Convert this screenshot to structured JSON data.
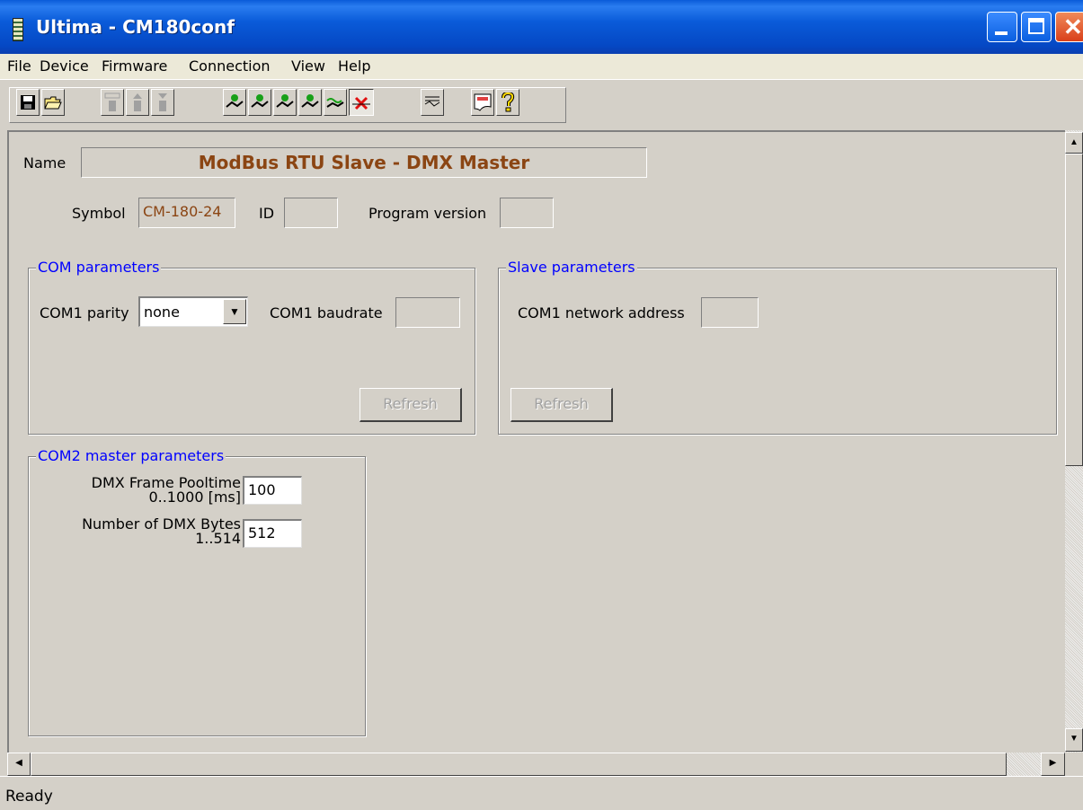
{
  "window": {
    "title": "Ultima - CM180conf"
  },
  "menu": [
    "File",
    "Device",
    "Firmware",
    "Connection",
    "View",
    "Help"
  ],
  "toolbar": {
    "buttons": [
      {
        "name": "save-icon"
      },
      {
        "name": "open-folder-icon"
      },
      {
        "name": "auto-device-icon",
        "label": "AUTO"
      },
      {
        "name": "device-upload-icon"
      },
      {
        "name": "device-download-icon"
      },
      {
        "name": "connection-1-icon"
      },
      {
        "name": "connection-2-icon"
      },
      {
        "name": "connection-3-icon"
      },
      {
        "name": "connection-4-icon"
      },
      {
        "name": "connection-wave-icon"
      },
      {
        "name": "disconnect-icon"
      },
      {
        "name": "monitor-icon"
      },
      {
        "name": "document-icon",
        "label": "DOC"
      },
      {
        "name": "help-icon",
        "label": "?"
      }
    ]
  },
  "device": {
    "name_label": "Name",
    "name_value": "ModBus RTU Slave - DMX Master",
    "symbol_label": "Symbol",
    "symbol_value": "CM-180-24",
    "id_label": "ID",
    "id_value": "",
    "program_version_label": "Program version",
    "program_version_value": ""
  },
  "com_parameters": {
    "caption": "COM parameters",
    "parity_label": "COM1 parity",
    "parity_value": "none",
    "baudrate_label": "COM1 baudrate",
    "baudrate_value": "",
    "refresh_label": "Refresh"
  },
  "slave_parameters": {
    "caption": "Slave parameters",
    "network_address_label": "COM1 network address",
    "network_address_value": "",
    "refresh_label": "Refresh"
  },
  "com2_master": {
    "caption": "COM2 master parameters",
    "pooltime_label_1": "DMX Frame Pooltime",
    "pooltime_label_2": "0..1000 [ms]",
    "pooltime_value": "100",
    "bytes_label_1": "Number of DMX Bytes",
    "bytes_label_2": "1..514",
    "bytes_value": "512"
  },
  "status": {
    "text": "Ready"
  }
}
